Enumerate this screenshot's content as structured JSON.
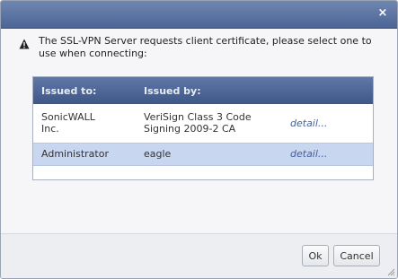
{
  "dialog": {
    "close_symbol": "×",
    "message": "The SSL-VPN Server requests client certificate, please select one to use when connecting:",
    "warning_icon": "warning-triangle-icon"
  },
  "table": {
    "headers": {
      "issued_to": "Issued to:",
      "issued_by": "Issued by:"
    },
    "rows": [
      {
        "issued_to_line1": "SonicWALL",
        "issued_to_line2": "Inc.",
        "issued_by_line1": "VeriSign Class 3 Code",
        "issued_by_line2": "Signing 2009-2 CA",
        "detail": "detail..."
      },
      {
        "issued_to_line1": "Administrator",
        "issued_by_line1": "eagle",
        "detail": "detail..."
      }
    ]
  },
  "buttons": {
    "ok": "Ok",
    "cancel": "Cancel"
  }
}
